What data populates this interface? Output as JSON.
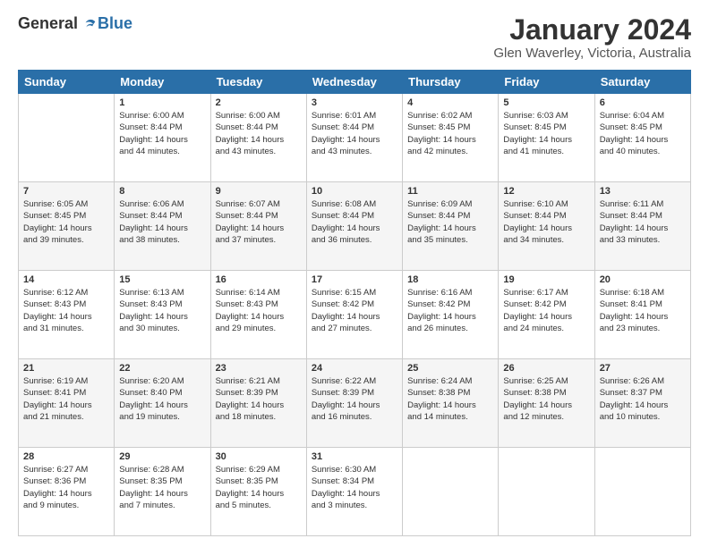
{
  "logo": {
    "general": "General",
    "blue": "Blue"
  },
  "header": {
    "title": "January 2024",
    "subtitle": "Glen Waverley, Victoria, Australia"
  },
  "columns": [
    "Sunday",
    "Monday",
    "Tuesday",
    "Wednesday",
    "Thursday",
    "Friday",
    "Saturday"
  ],
  "weeks": [
    [
      {
        "day": "",
        "content": ""
      },
      {
        "day": "1",
        "content": "Sunrise: 6:00 AM\nSunset: 8:44 PM\nDaylight: 14 hours\nand 44 minutes."
      },
      {
        "day": "2",
        "content": "Sunrise: 6:00 AM\nSunset: 8:44 PM\nDaylight: 14 hours\nand 43 minutes."
      },
      {
        "day": "3",
        "content": "Sunrise: 6:01 AM\nSunset: 8:44 PM\nDaylight: 14 hours\nand 43 minutes."
      },
      {
        "day": "4",
        "content": "Sunrise: 6:02 AM\nSunset: 8:45 PM\nDaylight: 14 hours\nand 42 minutes."
      },
      {
        "day": "5",
        "content": "Sunrise: 6:03 AM\nSunset: 8:45 PM\nDaylight: 14 hours\nand 41 minutes."
      },
      {
        "day": "6",
        "content": "Sunrise: 6:04 AM\nSunset: 8:45 PM\nDaylight: 14 hours\nand 40 minutes."
      }
    ],
    [
      {
        "day": "7",
        "content": "Sunrise: 6:05 AM\nSunset: 8:45 PM\nDaylight: 14 hours\nand 39 minutes."
      },
      {
        "day": "8",
        "content": "Sunrise: 6:06 AM\nSunset: 8:44 PM\nDaylight: 14 hours\nand 38 minutes."
      },
      {
        "day": "9",
        "content": "Sunrise: 6:07 AM\nSunset: 8:44 PM\nDaylight: 14 hours\nand 37 minutes."
      },
      {
        "day": "10",
        "content": "Sunrise: 6:08 AM\nSunset: 8:44 PM\nDaylight: 14 hours\nand 36 minutes."
      },
      {
        "day": "11",
        "content": "Sunrise: 6:09 AM\nSunset: 8:44 PM\nDaylight: 14 hours\nand 35 minutes."
      },
      {
        "day": "12",
        "content": "Sunrise: 6:10 AM\nSunset: 8:44 PM\nDaylight: 14 hours\nand 34 minutes."
      },
      {
        "day": "13",
        "content": "Sunrise: 6:11 AM\nSunset: 8:44 PM\nDaylight: 14 hours\nand 33 minutes."
      }
    ],
    [
      {
        "day": "14",
        "content": "Sunrise: 6:12 AM\nSunset: 8:43 PM\nDaylight: 14 hours\nand 31 minutes."
      },
      {
        "day": "15",
        "content": "Sunrise: 6:13 AM\nSunset: 8:43 PM\nDaylight: 14 hours\nand 30 minutes."
      },
      {
        "day": "16",
        "content": "Sunrise: 6:14 AM\nSunset: 8:43 PM\nDaylight: 14 hours\nand 29 minutes."
      },
      {
        "day": "17",
        "content": "Sunrise: 6:15 AM\nSunset: 8:42 PM\nDaylight: 14 hours\nand 27 minutes."
      },
      {
        "day": "18",
        "content": "Sunrise: 6:16 AM\nSunset: 8:42 PM\nDaylight: 14 hours\nand 26 minutes."
      },
      {
        "day": "19",
        "content": "Sunrise: 6:17 AM\nSunset: 8:42 PM\nDaylight: 14 hours\nand 24 minutes."
      },
      {
        "day": "20",
        "content": "Sunrise: 6:18 AM\nSunset: 8:41 PM\nDaylight: 14 hours\nand 23 minutes."
      }
    ],
    [
      {
        "day": "21",
        "content": "Sunrise: 6:19 AM\nSunset: 8:41 PM\nDaylight: 14 hours\nand 21 minutes."
      },
      {
        "day": "22",
        "content": "Sunrise: 6:20 AM\nSunset: 8:40 PM\nDaylight: 14 hours\nand 19 minutes."
      },
      {
        "day": "23",
        "content": "Sunrise: 6:21 AM\nSunset: 8:39 PM\nDaylight: 14 hours\nand 18 minutes."
      },
      {
        "day": "24",
        "content": "Sunrise: 6:22 AM\nSunset: 8:39 PM\nDaylight: 14 hours\nand 16 minutes."
      },
      {
        "day": "25",
        "content": "Sunrise: 6:24 AM\nSunset: 8:38 PM\nDaylight: 14 hours\nand 14 minutes."
      },
      {
        "day": "26",
        "content": "Sunrise: 6:25 AM\nSunset: 8:38 PM\nDaylight: 14 hours\nand 12 minutes."
      },
      {
        "day": "27",
        "content": "Sunrise: 6:26 AM\nSunset: 8:37 PM\nDaylight: 14 hours\nand 10 minutes."
      }
    ],
    [
      {
        "day": "28",
        "content": "Sunrise: 6:27 AM\nSunset: 8:36 PM\nDaylight: 14 hours\nand 9 minutes."
      },
      {
        "day": "29",
        "content": "Sunrise: 6:28 AM\nSunset: 8:35 PM\nDaylight: 14 hours\nand 7 minutes."
      },
      {
        "day": "30",
        "content": "Sunrise: 6:29 AM\nSunset: 8:35 PM\nDaylight: 14 hours\nand 5 minutes."
      },
      {
        "day": "31",
        "content": "Sunrise: 6:30 AM\nSunset: 8:34 PM\nDaylight: 14 hours\nand 3 minutes."
      },
      {
        "day": "",
        "content": ""
      },
      {
        "day": "",
        "content": ""
      },
      {
        "day": "",
        "content": ""
      }
    ]
  ]
}
